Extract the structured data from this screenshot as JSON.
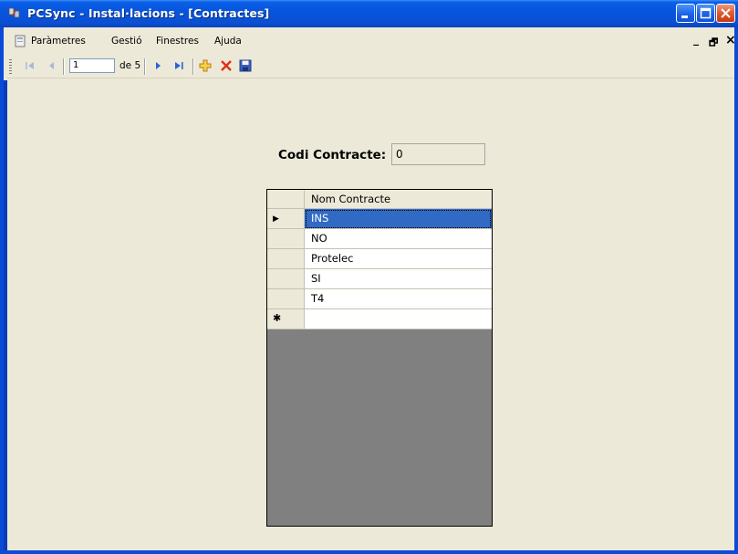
{
  "window": {
    "title": "PCSync - Instal·lacions - [Contractes]",
    "accent": "#0a4fd2"
  },
  "menubar": {
    "items": [
      "Paràmetres",
      "Gestió",
      "Finestres",
      "Ajuda"
    ],
    "mdi_minimize": "_",
    "mdi_restore": "🗗",
    "mdi_close": "×"
  },
  "toolbar": {
    "position_value": "1",
    "count_label": "de 5"
  },
  "form": {
    "codi_label": "Codi Contracte:",
    "codi_value": "0"
  },
  "grid": {
    "column_header": "Nom Contracte",
    "rows": [
      "INS",
      "NO",
      "Protelec",
      "SI",
      "T4",
      ""
    ],
    "current_marker": "▶",
    "new_marker": "✱",
    "selected_color": "#316ac5"
  }
}
